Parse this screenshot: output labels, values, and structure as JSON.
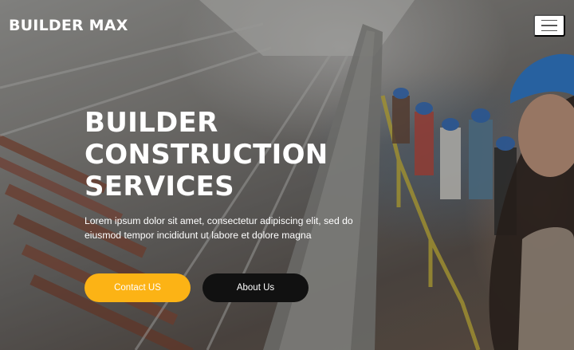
{
  "brand": {
    "name": "BUILDER MAX"
  },
  "navbar": {
    "toggle_icon": "hamburger-menu-icon"
  },
  "hero": {
    "title_lines": [
      "BUILDER",
      "CONSTRUCTION",
      "SERVICES"
    ],
    "description": "Lorem ipsum dolor sit amet, consectetur adipiscing elit, sed do eiusmod tempor incididunt ut labore et dolore magna",
    "contact_label": "Contact US",
    "about_label": "About Us"
  },
  "colors": {
    "accent": "#fcb315",
    "dark_button": "#111111",
    "text": "#ffffff"
  }
}
